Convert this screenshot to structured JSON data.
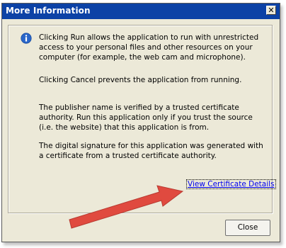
{
  "dialog": {
    "title": "More Information",
    "close_glyph": "✕",
    "paragraphs": [
      "Clicking Run allows the application to run with unrestricted access to your personal files and other resources on your computer (for example, the web cam and microphone).",
      "Clicking Cancel prevents the application from running.",
      "The publisher name is verified by a trusted certificate authority. Run this application only if you trust the source (i.e. the website) that this application is from.",
      "The digital signature for this application was generated with a certificate from a trusted certificate authority."
    ],
    "link_label": "View Certificate Details",
    "close_button_label": "Close"
  },
  "icons": {
    "info": "info-icon",
    "title_close": "close-icon",
    "annotation": "arrow-icon"
  },
  "colors": {
    "title_bar": "#0c42a6",
    "dialog_bg": "#ece9d8",
    "link": "#0000ee",
    "annotation_arrow": "#e04a3f"
  }
}
